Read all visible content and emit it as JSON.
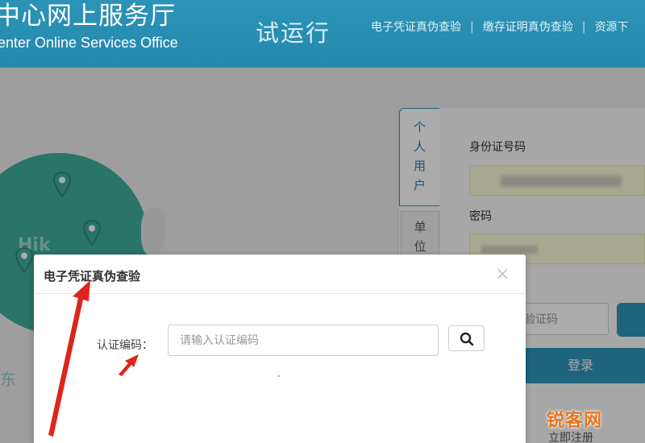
{
  "header": {
    "title": "中心网上服务厅",
    "subtitle": "enter Online Services Office",
    "trial_label": "试运行",
    "nav": [
      {
        "label": "电子凭证真伪查验"
      },
      {
        "label": "缴存证明真伪查验"
      },
      {
        "label": "资源下"
      }
    ]
  },
  "background": {
    "map_text": "Hik",
    "map_text2": "东",
    "login": {
      "tab_personal": [
        "个",
        "人",
        "用",
        "户"
      ],
      "tab_unit": [
        "单",
        "位"
      ],
      "id_label": "身份证号码",
      "password_label": "密码",
      "captcha_placeholder": "验证码",
      "login_button": "登录",
      "register_link": "立即注册"
    }
  },
  "modal": {
    "title": "电子凭证真伪查验",
    "close_symbol": "×",
    "code_label": "认证编码：",
    "code_placeholder": "请输入认证编码",
    "code_value": ""
  },
  "watermark": "锐客网",
  "colors": {
    "header_bg": "#2c93b8",
    "accent": "#2d95bb",
    "map_green": "#3fae9b",
    "annotation_red": "#e0241b",
    "watermark_orange": "#e8731c"
  }
}
